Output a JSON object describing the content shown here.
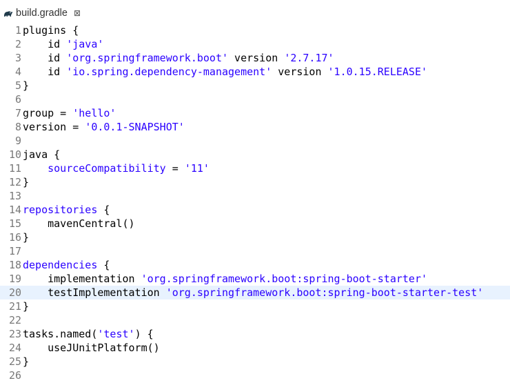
{
  "tab": {
    "title": "build.gradle",
    "close_glyph": "⊠",
    "icon": "gradle-elephant-icon"
  },
  "editor": {
    "current_line": 20,
    "colors": {
      "line_number": "#787878",
      "string": "#2a00ff",
      "current_line_bg": "#e8f2fe"
    },
    "lines": [
      {
        "n": "1",
        "tokens": [
          {
            "t": "plugins {",
            "c": "plain"
          }
        ]
      },
      {
        "n": "2",
        "tokens": [
          {
            "t": "    id ",
            "c": "plain"
          },
          {
            "t": "'java'",
            "c": "str"
          }
        ]
      },
      {
        "n": "3",
        "tokens": [
          {
            "t": "    id ",
            "c": "plain"
          },
          {
            "t": "'org.springframework.boot'",
            "c": "str"
          },
          {
            "t": " version ",
            "c": "plain"
          },
          {
            "t": "'2.7.17'",
            "c": "str"
          }
        ]
      },
      {
        "n": "4",
        "tokens": [
          {
            "t": "    id ",
            "c": "plain"
          },
          {
            "t": "'io.spring.dependency-management'",
            "c": "str"
          },
          {
            "t": " version ",
            "c": "plain"
          },
          {
            "t": "'1.0.15.RELEASE'",
            "c": "str"
          }
        ]
      },
      {
        "n": "5",
        "tokens": [
          {
            "t": "}",
            "c": "plain"
          }
        ]
      },
      {
        "n": "6",
        "tokens": []
      },
      {
        "n": "7",
        "tokens": [
          {
            "t": "group = ",
            "c": "plain"
          },
          {
            "t": "'hello'",
            "c": "str"
          }
        ]
      },
      {
        "n": "8",
        "tokens": [
          {
            "t": "version = ",
            "c": "plain"
          },
          {
            "t": "'0.0.1-SNAPSHOT'",
            "c": "str"
          }
        ]
      },
      {
        "n": "9",
        "tokens": []
      },
      {
        "n": "10",
        "tokens": [
          {
            "t": "java {",
            "c": "plain"
          }
        ]
      },
      {
        "n": "11",
        "tokens": [
          {
            "t": "    sourceCompatibility",
            "c": "str"
          },
          {
            "t": " = ",
            "c": "plain"
          },
          {
            "t": "'11'",
            "c": "str"
          }
        ]
      },
      {
        "n": "12",
        "tokens": [
          {
            "t": "}",
            "c": "plain"
          }
        ]
      },
      {
        "n": "13",
        "tokens": []
      },
      {
        "n": "14",
        "tokens": [
          {
            "t": "repositories",
            "c": "str"
          },
          {
            "t": " {",
            "c": "plain"
          }
        ]
      },
      {
        "n": "15",
        "tokens": [
          {
            "t": "    mavenCentral()",
            "c": "plain"
          }
        ]
      },
      {
        "n": "16",
        "tokens": [
          {
            "t": "}",
            "c": "plain"
          }
        ]
      },
      {
        "n": "17",
        "tokens": []
      },
      {
        "n": "18",
        "tokens": [
          {
            "t": "dependencies",
            "c": "str"
          },
          {
            "t": " {",
            "c": "plain"
          }
        ]
      },
      {
        "n": "19",
        "tokens": [
          {
            "t": "    implementation ",
            "c": "plain"
          },
          {
            "t": "'org.springframework.boot:spring-boot-starter'",
            "c": "str"
          }
        ]
      },
      {
        "n": "20",
        "tokens": [
          {
            "t": "    testImplementation ",
            "c": "plain"
          },
          {
            "t": "'org.springframework.boot:spring-boot-starter-test'",
            "c": "str"
          }
        ]
      },
      {
        "n": "21",
        "tokens": [
          {
            "t": "}",
            "c": "plain"
          }
        ]
      },
      {
        "n": "22",
        "tokens": []
      },
      {
        "n": "23",
        "tokens": [
          {
            "t": "tasks.named(",
            "c": "plain"
          },
          {
            "t": "'test'",
            "c": "str"
          },
          {
            "t": ") {",
            "c": "plain"
          }
        ]
      },
      {
        "n": "24",
        "tokens": [
          {
            "t": "    useJUnitPlatform()",
            "c": "plain"
          }
        ]
      },
      {
        "n": "25",
        "tokens": [
          {
            "t": "}",
            "c": "plain"
          }
        ]
      },
      {
        "n": "26",
        "tokens": []
      }
    ]
  }
}
